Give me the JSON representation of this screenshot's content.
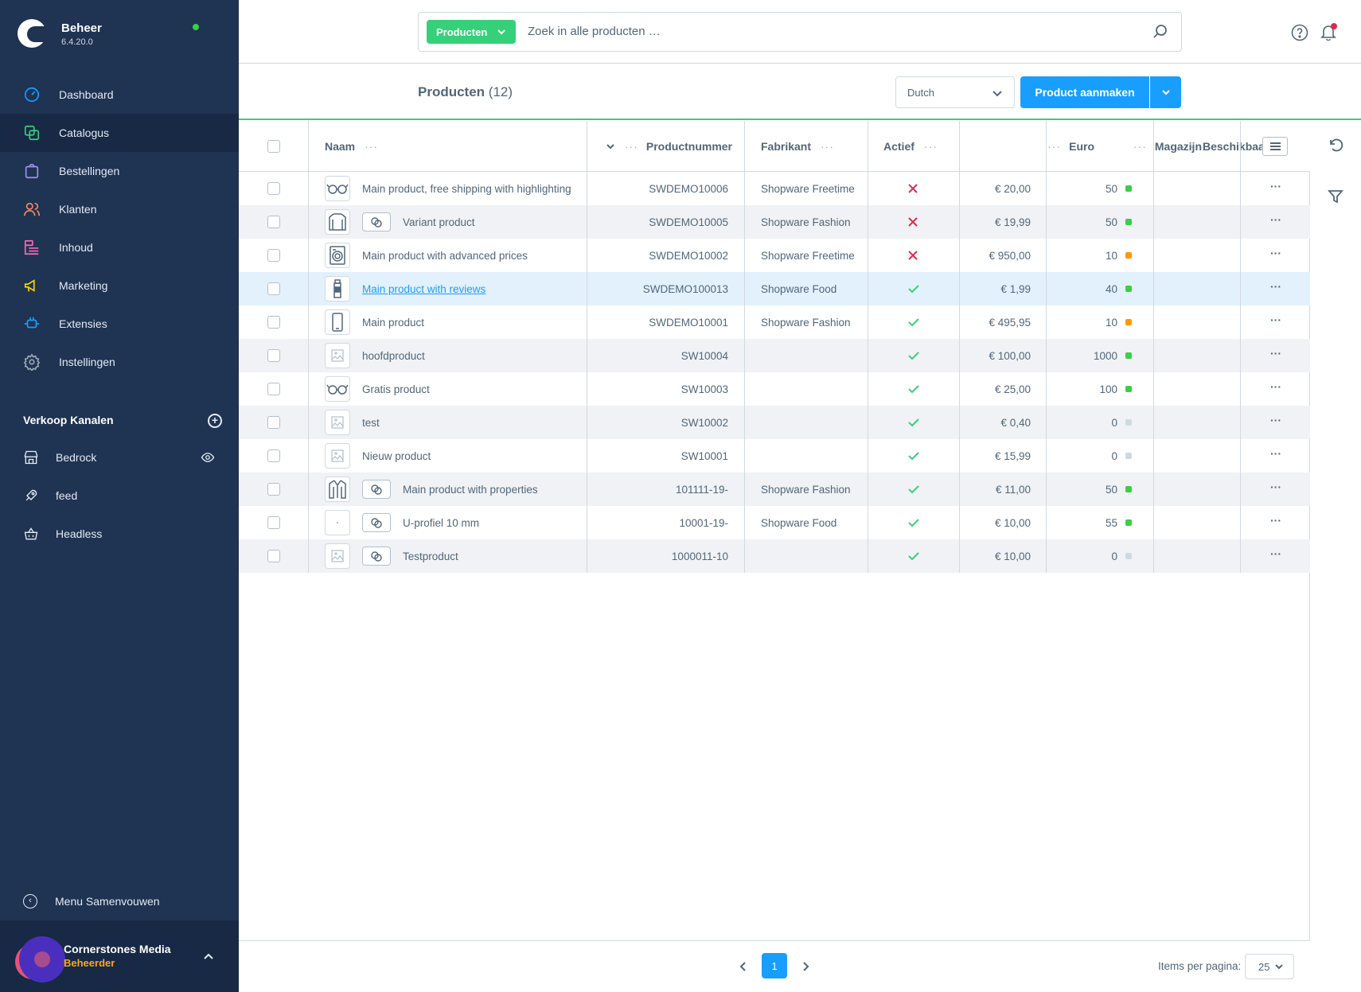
{
  "app": {
    "title": "Beheer",
    "version": "6.4.20.0",
    "status_color": "#37d046"
  },
  "nav": [
    {
      "label": "Dashboard",
      "icon": "dashboard-icon",
      "color": "#189eff",
      "active": false
    },
    {
      "label": "Catalogus",
      "icon": "catalog-icon",
      "color": "#37d07a",
      "active": true
    },
    {
      "label": "Bestellingen",
      "icon": "orders-icon",
      "color": "#a092f0",
      "active": false
    },
    {
      "label": "Klanten",
      "icon": "customers-icon",
      "color": "#f88962",
      "active": false
    },
    {
      "label": "Inhoud",
      "icon": "content-icon",
      "color": "#ff68b4",
      "active": false
    },
    {
      "label": "Marketing",
      "icon": "marketing-icon",
      "color": "#ffd700",
      "active": false
    },
    {
      "label": "Extensies",
      "icon": "extensions-icon",
      "color": "#189eff",
      "active": false
    },
    {
      "label": "Instellingen",
      "icon": "settings-icon",
      "color": "#9aa8b5",
      "active": false
    }
  ],
  "sales_channels": {
    "title": "Verkoop Kanalen",
    "items": [
      {
        "label": "Bedrock",
        "icon": "storefront-icon"
      },
      {
        "label": "feed",
        "icon": "rocket-icon"
      },
      {
        "label": "Headless",
        "icon": "basket-icon"
      }
    ]
  },
  "collapse_label": "Menu Samenvouwen",
  "user": {
    "name": "Cornerstones Media",
    "role": "Beheerder"
  },
  "search": {
    "type_label": "Producten",
    "placeholder": "Zoek in alle producten …"
  },
  "smartbar": {
    "title": "Producten",
    "count": "(12)",
    "language": "Dutch",
    "create_label": "Product aanmaken"
  },
  "columns": {
    "name": "Naam",
    "number": "Productnummer",
    "manufacturer": "Fabrikant",
    "active": "Actief",
    "price": "Euro",
    "stock": "Magazijn",
    "available": "Beschikbaar"
  },
  "products": [
    {
      "name": "Main product, free shipping with highlighting",
      "number": "SWDEMO10006",
      "manufacturer": "Shopware Freetime",
      "active": false,
      "price": "€ 20,00",
      "stock": "50",
      "stock_color": "#37d046",
      "thumb": "glasses-icon",
      "variant": false,
      "link": false
    },
    {
      "name": "Variant product",
      "number": "SWDEMO10005",
      "manufacturer": "Shopware Fashion",
      "active": false,
      "price": "€ 19,99",
      "stock": "50",
      "stock_color": "#37d046",
      "thumb": "shirt-icon",
      "variant": true,
      "link": false
    },
    {
      "name": "Main product with advanced prices",
      "number": "SWDEMO10002",
      "manufacturer": "Shopware Freetime",
      "active": false,
      "price": "€ 950,00",
      "stock": "10",
      "stock_color": "#ff9800",
      "thumb": "washer-icon",
      "variant": false,
      "link": false
    },
    {
      "name": "Main product with reviews",
      "number": "SWDEMO100013",
      "manufacturer": "Shopware Food",
      "active": true,
      "price": "€ 1,99",
      "stock": "40",
      "stock_color": "#37d046",
      "thumb": "bottle-icon",
      "variant": false,
      "link": true
    },
    {
      "name": "Main product",
      "number": "SWDEMO10001",
      "manufacturer": "Shopware Fashion",
      "active": true,
      "price": "€ 495,95",
      "stock": "10",
      "stock_color": "#ff9800",
      "thumb": "phone-icon",
      "variant": false,
      "link": false
    },
    {
      "name": "hoofdproduct",
      "number": "SW10004",
      "manufacturer": "",
      "active": true,
      "price": "€ 100,00",
      "stock": "1000",
      "stock_color": "#37d046",
      "thumb": "image-placeholder-icon",
      "variant": false,
      "link": false
    },
    {
      "name": "Gratis product",
      "number": "SW10003",
      "manufacturer": "",
      "active": true,
      "price": "€ 25,00",
      "stock": "100",
      "stock_color": "#37d046",
      "thumb": "glasses-icon",
      "variant": false,
      "link": false
    },
    {
      "name": "test",
      "number": "SW10002",
      "manufacturer": "",
      "active": true,
      "price": "€ 0,40",
      "stock": "0",
      "stock_color": "#d1d9e0",
      "thumb": "image-placeholder-icon",
      "variant": false,
      "link": false
    },
    {
      "name": "Nieuw product",
      "number": "SW10001",
      "manufacturer": "",
      "active": true,
      "price": "€ 15,99",
      "stock": "0",
      "stock_color": "#d1d9e0",
      "thumb": "image-placeholder-icon",
      "variant": false,
      "link": false
    },
    {
      "name": "Main product with properties",
      "number": "101111-19-",
      "manufacturer": "Shopware Fashion",
      "active": true,
      "price": "€ 11,00",
      "stock": "50",
      "stock_color": "#37d046",
      "thumb": "jacket-icon",
      "variant": true,
      "link": false
    },
    {
      "name": "U-profiel 10 mm",
      "number": "10001-19-",
      "manufacturer": "Shopware Food",
      "active": true,
      "price": "€ 10,00",
      "stock": "55",
      "stock_color": "#37d046",
      "thumb": "dot-thumb-icon",
      "variant": true,
      "link": false
    },
    {
      "name": "Testproduct",
      "number": "1000011-10",
      "manufacturer": "",
      "active": true,
      "price": "€ 10,00",
      "stock": "0",
      "stock_color": "#d1d9e0",
      "thumb": "image-placeholder-icon",
      "variant": true,
      "link": false
    }
  ],
  "pagination": {
    "current": "1",
    "items_label": "Items per pagina:",
    "items_per_page": "25"
  },
  "colors": {
    "accent": "#189eff",
    "success": "#37d07a",
    "danger": "#de294c",
    "sidebar": "#1f3352"
  }
}
